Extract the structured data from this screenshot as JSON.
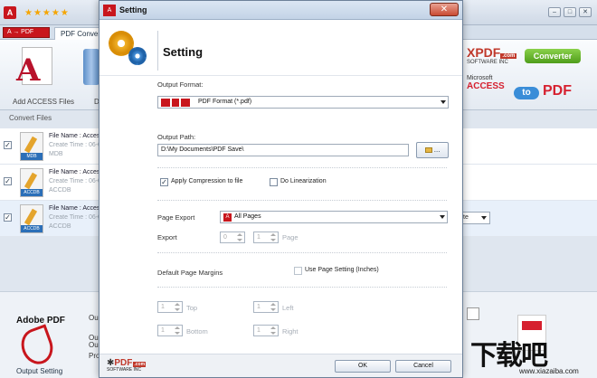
{
  "app": {
    "stars": "★★★★★",
    "tab_label": "PDF Conversi",
    "ribbon_add_label": "Add ACCESS Files",
    "ribbon_delete_label": "D",
    "brand_logo_text": "XPDF",
    "brand_logo_com": ".com",
    "brand_logo_sub": "SOFTWARE INC",
    "converter_badge": "Converter",
    "ms_label": "Microsoft",
    "access_label": "ACCESS",
    "to_label": "to",
    "pdf_label": "PDF",
    "convert_files_header": "Convert Files",
    "row_select_value": "te",
    "files": [
      {
        "name": "File Name : Access",
        "created": "Create Time : 06-0",
        "type": "MDB",
        "icon_tag": "MDB",
        "checked": true
      },
      {
        "name": "File Name : Access",
        "created": "Create Time : 06-0",
        "type": "ACCDB",
        "icon_tag": "ACCDB",
        "checked": true
      },
      {
        "name": "File Name : Access",
        "created": "Create Time : 06-0",
        "type": "ACCDB",
        "icon_tag": "ACCDB",
        "checked": true
      }
    ],
    "adobe_logo": "Adobe PDF",
    "side_labels": [
      "Ou",
      "Ou",
      "Ou",
      "Pro"
    ],
    "output_setting": "Output Setting",
    "watermark_big": "下载吧",
    "watermark_small": "www.xiazaiba.com"
  },
  "dialog": {
    "title": "Setting",
    "close_label": "✕",
    "heading": "Setting",
    "output_format_label": "Output Format:",
    "output_format_value": "PDF Format (*.pdf)",
    "output_path_label": "Output Path:",
    "output_path_value": "D:\\My Documents\\PDF Save\\",
    "browse_label": "...",
    "apply_compression": {
      "label": "Apply Compression to file",
      "checked": true
    },
    "linearization": {
      "label": "Do Linearization",
      "checked": false
    },
    "page_export_label": "Page Export",
    "page_export_value": "All Pages",
    "export_label": "Export",
    "export_from": "0",
    "export_to": "1",
    "export_page_label": "Page",
    "margins_label": "Default Page Margins",
    "use_page_setting": {
      "label": "Use Page Setting (Inches)",
      "checked": false
    },
    "margin_top": {
      "value": "1",
      "label": "Top"
    },
    "margin_left": {
      "value": "1",
      "label": "Left"
    },
    "margin_bottom": {
      "value": "1",
      "label": "Bottom"
    },
    "margin_right": {
      "value": "1",
      "label": "Right"
    },
    "footer_logo_text": "PDF",
    "footer_logo_com": ".com",
    "footer_logo_sub": "SOFTWARE INC",
    "ok_label": "OK",
    "cancel_label": "Cancel"
  },
  "colors": {
    "accent_red": "#c8161d",
    "brand_green": "#4f9d1b",
    "brand_blue": "#3a8dd8"
  }
}
